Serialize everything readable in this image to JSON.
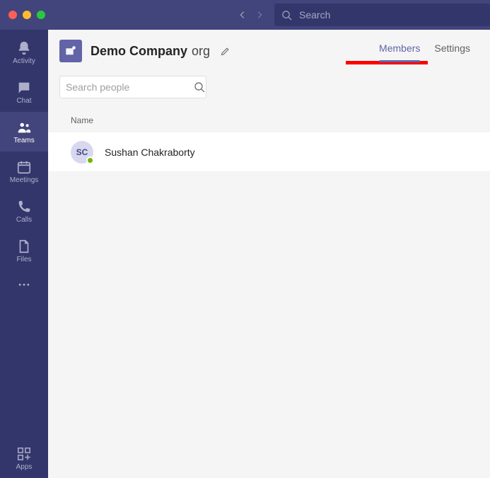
{
  "titlebar": {
    "search_placeholder": "Search"
  },
  "rail": {
    "items": [
      {
        "label": "Activity"
      },
      {
        "label": "Chat"
      },
      {
        "label": "Teams"
      },
      {
        "label": "Meetings"
      },
      {
        "label": "Calls"
      },
      {
        "label": "Files"
      }
    ],
    "bottom": {
      "label": "Apps"
    }
  },
  "team": {
    "name": "Demo Company",
    "suffix": "org"
  },
  "tabs": {
    "members": "Members",
    "settings": "Settings"
  },
  "search_people_placeholder": "Search people",
  "columns": {
    "name": "Name"
  },
  "members": [
    {
      "initials": "SC",
      "name": "Sushan Chakraborty"
    }
  ]
}
